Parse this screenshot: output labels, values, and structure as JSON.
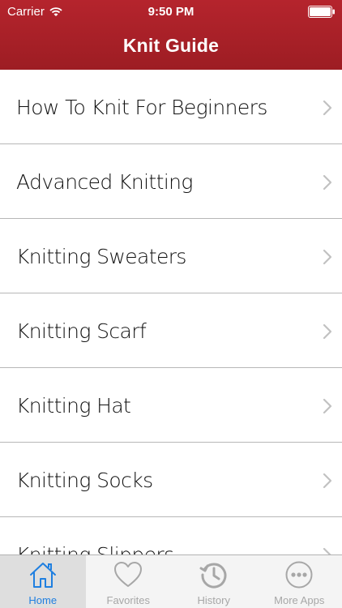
{
  "status_bar": {
    "carrier": "Carrier",
    "time": "9:50 PM"
  },
  "nav": {
    "title": "Knit Guide"
  },
  "list": {
    "items": [
      {
        "label": "How To Knit For Beginners"
      },
      {
        "label": "Advanced Knitting"
      },
      {
        "label": "Knitting Sweaters"
      },
      {
        "label": "Knitting Scarf"
      },
      {
        "label": "Knitting Hat"
      },
      {
        "label": "Knitting Socks"
      },
      {
        "label": "Knitting Slippers"
      }
    ]
  },
  "tabbar": {
    "tabs": [
      {
        "label": "Home",
        "icon": "home-icon",
        "active": true
      },
      {
        "label": "Favorites",
        "icon": "heart-icon",
        "active": false
      },
      {
        "label": "History",
        "icon": "history-icon",
        "active": false
      },
      {
        "label": "More Apps",
        "icon": "more-icon",
        "active": false
      }
    ]
  },
  "colors": {
    "header": "#a91f27",
    "tab_active": "#1f7fe0",
    "tab_inactive": "#a7a7a7"
  }
}
